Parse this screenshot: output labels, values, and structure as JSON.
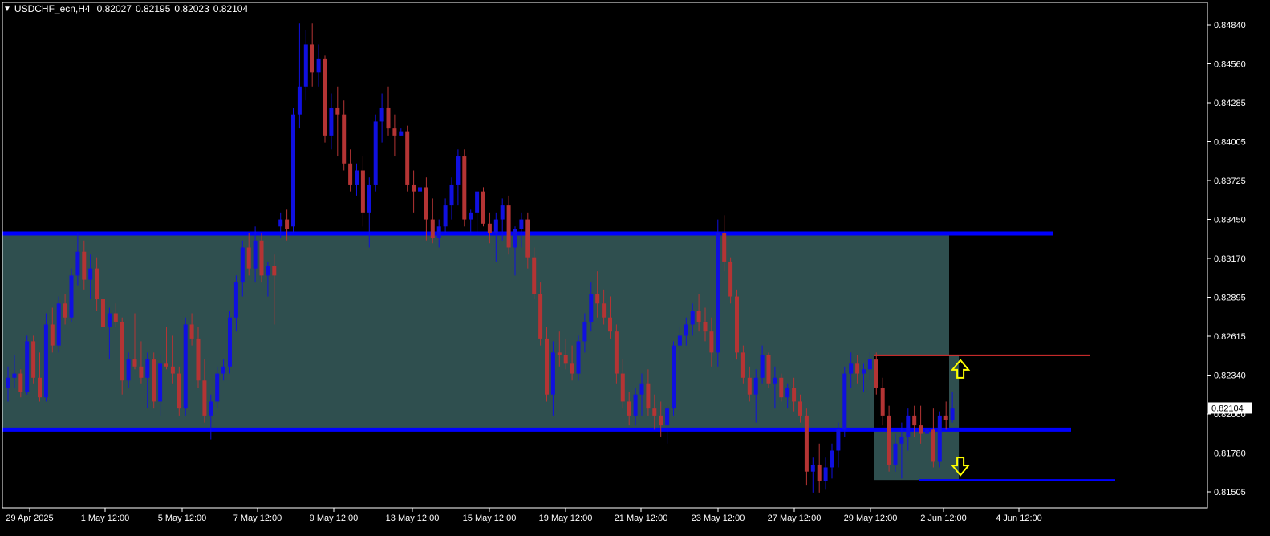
{
  "header": {
    "symbol": "USDCHF_ecn,H4",
    "open": "0.82027",
    "high": "0.82195",
    "low": "0.82023",
    "close": "0.82104"
  },
  "colors": {
    "background": "#000000",
    "frame": "#ffffff",
    "bull_candle": "#1010e0",
    "bear_candle": "#b43434",
    "range_zone": "#2f4f4f",
    "level_line": "#0000ff",
    "resistance_line": "#e03030",
    "arrow": "#ffff00",
    "price_line": "#a0a0a0"
  },
  "chart_data": {
    "type": "candlestick",
    "symbol": "USDCHF_ecn",
    "timeframe": "H4",
    "y_ticks": [
      "0.84840",
      "0.84560",
      "0.84285",
      "0.84005",
      "0.83725",
      "0.83450",
      "0.83170",
      "0.82895",
      "0.82615",
      "0.82340",
      "0.82060",
      "0.81780",
      "0.81505"
    ],
    "x_ticks": [
      "29 Apr 2025",
      "1 May 12:00",
      "5 May 12:00",
      "7 May 12:00",
      "9 May 12:00",
      "13 May 12:00",
      "15 May 12:00",
      "19 May 12:00",
      "21 May 12:00",
      "23 May 12:00",
      "27 May 12:00",
      "29 May 12:00",
      "2 Jun 12:00",
      "4 Jun 12:00"
    ],
    "ylim": [
      0.814,
      0.85
    ],
    "current_price": "0.82104",
    "range_upper": 0.8335,
    "range_lower": 0.8195,
    "resistance": 0.8248,
    "support": 0.8159,
    "candles": [
      [
        0.8225,
        0.824,
        0.8215,
        0.8232
      ],
      [
        0.8232,
        0.8248,
        0.8225,
        0.8235
      ],
      [
        0.8235,
        0.8238,
        0.8218,
        0.8222
      ],
      [
        0.8222,
        0.8262,
        0.822,
        0.8258
      ],
      [
        0.8258,
        0.8262,
        0.8228,
        0.8232
      ],
      [
        0.8232,
        0.825,
        0.8215,
        0.8218
      ],
      [
        0.8218,
        0.8278,
        0.8215,
        0.827
      ],
      [
        0.827,
        0.8282,
        0.825,
        0.8255
      ],
      [
        0.8255,
        0.829,
        0.825,
        0.8285
      ],
      [
        0.8285,
        0.8292,
        0.827,
        0.8275
      ],
      [
        0.8275,
        0.831,
        0.8272,
        0.8305
      ],
      [
        0.8305,
        0.8335,
        0.8298,
        0.8322
      ],
      [
        0.8322,
        0.833,
        0.8295,
        0.8302
      ],
      [
        0.8302,
        0.832,
        0.8288,
        0.831
      ],
      [
        0.831,
        0.8318,
        0.828,
        0.8288
      ],
      [
        0.8288,
        0.8292,
        0.8262,
        0.8268
      ],
      [
        0.8268,
        0.8282,
        0.8245,
        0.8278
      ],
      [
        0.8278,
        0.8285,
        0.8268,
        0.8272
      ],
      [
        0.8272,
        0.8275,
        0.822,
        0.823
      ],
      [
        0.823,
        0.825,
        0.8225,
        0.8245
      ],
      [
        0.8245,
        0.8278,
        0.8238,
        0.824
      ],
      [
        0.824,
        0.8258,
        0.8228,
        0.8232
      ],
      [
        0.8232,
        0.825,
        0.821,
        0.8245
      ],
      [
        0.8245,
        0.825,
        0.821,
        0.8215
      ],
      [
        0.8215,
        0.8248,
        0.8205,
        0.8242
      ],
      [
        0.8242,
        0.8268,
        0.8238,
        0.824
      ],
      [
        0.824,
        0.8262,
        0.8228,
        0.8235
      ],
      [
        0.8235,
        0.824,
        0.8205,
        0.821
      ],
      [
        0.821,
        0.8275,
        0.8205,
        0.827
      ],
      [
        0.827,
        0.8278,
        0.8255,
        0.826
      ],
      [
        0.826,
        0.8268,
        0.8225,
        0.823
      ],
      [
        0.823,
        0.8245,
        0.82,
        0.8205
      ],
      [
        0.8205,
        0.822,
        0.8188,
        0.8215
      ],
      [
        0.8215,
        0.824,
        0.821,
        0.8235
      ],
      [
        0.8235,
        0.8245,
        0.823,
        0.824
      ],
      [
        0.824,
        0.828,
        0.8235,
        0.8275
      ],
      [
        0.8275,
        0.8305,
        0.8265,
        0.83
      ],
      [
        0.83,
        0.833,
        0.829,
        0.8325
      ],
      [
        0.8325,
        0.8335,
        0.8305,
        0.831
      ],
      [
        0.831,
        0.834,
        0.83,
        0.833
      ],
      [
        0.833,
        0.8335,
        0.83,
        0.8305
      ],
      [
        0.8305,
        0.8315,
        0.829,
        0.8312
      ],
      [
        0.8312,
        0.832,
        0.827,
        0.8305
      ],
      [
        0.834,
        0.835,
        0.8332,
        0.8345
      ],
      [
        0.8345,
        0.8352,
        0.833,
        0.8338
      ],
      [
        0.834,
        0.8425,
        0.8335,
        0.842
      ],
      [
        0.842,
        0.8485,
        0.841,
        0.844
      ],
      [
        0.844,
        0.848,
        0.843,
        0.847
      ],
      [
        0.847,
        0.8485,
        0.844,
        0.845
      ],
      [
        0.845,
        0.847,
        0.844,
        0.846
      ],
      [
        0.846,
        0.8462,
        0.84,
        0.8405
      ],
      [
        0.8405,
        0.8435,
        0.8395,
        0.8425
      ],
      [
        0.8425,
        0.844,
        0.839,
        0.842
      ],
      [
        0.842,
        0.843,
        0.838,
        0.8385
      ],
      [
        0.8385,
        0.8395,
        0.8365,
        0.837
      ],
      [
        0.837,
        0.8385,
        0.8362,
        0.838
      ],
      [
        0.838,
        0.839,
        0.834,
        0.835
      ],
      [
        0.835,
        0.8375,
        0.8325,
        0.837
      ],
      [
        0.837,
        0.842,
        0.8365,
        0.8415
      ],
      [
        0.8415,
        0.8435,
        0.84,
        0.8425
      ],
      [
        0.8425,
        0.844,
        0.8405,
        0.841
      ],
      [
        0.841,
        0.842,
        0.839,
        0.8405
      ],
      [
        0.8405,
        0.841,
        0.8405,
        0.8408
      ],
      [
        0.8408,
        0.8412,
        0.8365,
        0.837
      ],
      [
        0.837,
        0.838,
        0.835,
        0.8365
      ],
      [
        0.8365,
        0.8375,
        0.8355,
        0.8368
      ],
      [
        0.8368,
        0.8375,
        0.833,
        0.8345
      ],
      [
        0.8345,
        0.836,
        0.8328,
        0.8332
      ],
      [
        0.8332,
        0.8345,
        0.8325,
        0.834
      ],
      [
        0.834,
        0.836,
        0.8335,
        0.8355
      ],
      [
        0.8355,
        0.8375,
        0.8345,
        0.837
      ],
      [
        0.837,
        0.8395,
        0.8355,
        0.839
      ],
      [
        0.839,
        0.8395,
        0.834,
        0.8345
      ],
      [
        0.8345,
        0.8352,
        0.8335,
        0.835
      ],
      [
        0.835,
        0.836,
        0.8335,
        0.8365
      ],
      [
        0.8365,
        0.8368,
        0.834,
        0.8342
      ],
      [
        0.8342,
        0.835,
        0.8328,
        0.8335
      ],
      [
        0.8335,
        0.835,
        0.8315,
        0.8345
      ],
      [
        0.8345,
        0.836,
        0.833,
        0.8355
      ],
      [
        0.8355,
        0.8362,
        0.832,
        0.8325
      ],
      [
        0.8325,
        0.834,
        0.8305,
        0.8338
      ],
      [
        0.8338,
        0.835,
        0.8325,
        0.8345
      ],
      [
        0.8345,
        0.835,
        0.831,
        0.8318
      ],
      [
        0.8318,
        0.8325,
        0.8288,
        0.8292
      ],
      [
        0.8292,
        0.83,
        0.8255,
        0.826
      ],
      [
        0.826,
        0.8268,
        0.8215,
        0.822
      ],
      [
        0.822,
        0.8258,
        0.8205,
        0.825
      ],
      [
        0.825,
        0.8265,
        0.824,
        0.8248
      ],
      [
        0.8248,
        0.826,
        0.8238,
        0.8242
      ],
      [
        0.8242,
        0.8255,
        0.823,
        0.8235
      ],
      [
        0.8235,
        0.8262,
        0.823,
        0.8258
      ],
      [
        0.8258,
        0.8278,
        0.825,
        0.8272
      ],
      [
        0.8272,
        0.83,
        0.8265,
        0.8292
      ],
      [
        0.8292,
        0.8308,
        0.8275,
        0.8285
      ],
      [
        0.8285,
        0.8295,
        0.827,
        0.8275
      ],
      [
        0.8275,
        0.829,
        0.826,
        0.8265
      ],
      [
        0.8265,
        0.827,
        0.8228,
        0.8235
      ],
      [
        0.8235,
        0.8245,
        0.821,
        0.8215
      ],
      [
        0.8215,
        0.8222,
        0.8198,
        0.8205
      ],
      [
        0.8205,
        0.8225,
        0.8198,
        0.822
      ],
      [
        0.822,
        0.8235,
        0.8205,
        0.8228
      ],
      [
        0.8228,
        0.8238,
        0.8205,
        0.821
      ],
      [
        0.821,
        0.822,
        0.8195,
        0.8205
      ],
      [
        0.8205,
        0.8215,
        0.819,
        0.8198
      ],
      [
        0.8198,
        0.8212,
        0.8185,
        0.821
      ],
      [
        0.821,
        0.8258,
        0.8205,
        0.8255
      ],
      [
        0.8255,
        0.8268,
        0.8245,
        0.8262
      ],
      [
        0.8262,
        0.8275,
        0.8255,
        0.827
      ],
      [
        0.827,
        0.8285,
        0.8262,
        0.828
      ],
      [
        0.828,
        0.8292,
        0.8265,
        0.8272
      ],
      [
        0.8272,
        0.8282,
        0.8258,
        0.8265
      ],
      [
        0.8265,
        0.8275,
        0.824,
        0.825
      ],
      [
        0.825,
        0.8345,
        0.824,
        0.8335
      ],
      [
        0.8335,
        0.8348,
        0.8308,
        0.8315
      ],
      [
        0.8315,
        0.8318,
        0.8285,
        0.829
      ],
      [
        0.829,
        0.8295,
        0.8245,
        0.825
      ],
      [
        0.825,
        0.8255,
        0.8228,
        0.8232
      ],
      [
        0.8232,
        0.824,
        0.8215,
        0.822
      ],
      [
        0.822,
        0.8238,
        0.82,
        0.8232
      ],
      [
        0.8232,
        0.8255,
        0.8228,
        0.8248
      ],
      [
        0.8248,
        0.825,
        0.8225,
        0.8228
      ],
      [
        0.8228,
        0.824,
        0.821,
        0.8232
      ],
      [
        0.8232,
        0.8235,
        0.8215,
        0.8218
      ],
      [
        0.8218,
        0.8228,
        0.821,
        0.8225
      ],
      [
        0.8225,
        0.8232,
        0.8208,
        0.8215
      ],
      [
        0.8215,
        0.822,
        0.82,
        0.8205
      ],
      [
        0.8205,
        0.821,
        0.8155,
        0.8165
      ],
      [
        0.8165,
        0.8175,
        0.815,
        0.817
      ],
      [
        0.817,
        0.8185,
        0.815,
        0.8158
      ],
      [
        0.8158,
        0.8175,
        0.8152,
        0.8168
      ],
      [
        0.8168,
        0.8185,
        0.816,
        0.818
      ],
      [
        0.818,
        0.82,
        0.8168,
        0.8195
      ],
      [
        0.8195,
        0.824,
        0.819,
        0.8235
      ],
      [
        0.8235,
        0.825,
        0.8225,
        0.8242
      ],
      [
        0.8242,
        0.8248,
        0.8228,
        0.8235
      ],
      [
        0.8235,
        0.8242,
        0.8222,
        0.8238
      ],
      [
        0.8238,
        0.825,
        0.823,
        0.8245
      ],
      [
        0.8245,
        0.825,
        0.822,
        0.8225
      ],
      [
        0.8225,
        0.8232,
        0.8198,
        0.8205
      ],
      [
        0.8205,
        0.8212,
        0.8165,
        0.817
      ],
      [
        0.817,
        0.8192,
        0.8165,
        0.8185
      ],
      [
        0.8185,
        0.82,
        0.816,
        0.819
      ],
      [
        0.819,
        0.821,
        0.818,
        0.8205
      ],
      [
        0.8205,
        0.8212,
        0.819,
        0.8198
      ],
      [
        0.8198,
        0.8212,
        0.8185,
        0.8192
      ],
      [
        0.8192,
        0.82,
        0.817,
        0.8195
      ],
      [
        0.8195,
        0.821,
        0.8168,
        0.8172
      ],
      [
        0.8172,
        0.8208,
        0.8168,
        0.8205
      ],
      [
        0.8205,
        0.8215,
        0.8195,
        0.8202
      ],
      [
        0.8202,
        0.8222,
        0.82,
        0.821
      ]
    ]
  }
}
